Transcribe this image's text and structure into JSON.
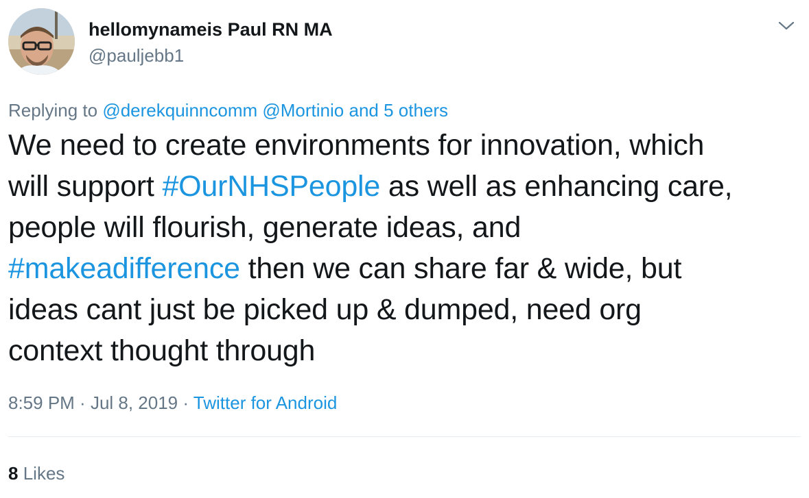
{
  "author": {
    "display_name": "hellomynameis Paul RN MA",
    "handle": "@pauljebb1"
  },
  "reply_context": {
    "prefix": "Replying to",
    "mention_1": "@derekquinncomm",
    "mention_2": "@Mortinio",
    "others": "and 5 others"
  },
  "tweet": {
    "line_1": "We need to create environments for innovation, which",
    "line_2_pre": "will support ",
    "hashtag_1": "#OurNHSPeople",
    "line_2_post": " as well as enhancing care,",
    "line_3": "people will flourish, generate ideas, and",
    "hashtag_2": "#makeadifference",
    "line_4_post": " then we can share far & wide, but",
    "line_5": "ideas cant just be picked up & dumped, need org",
    "line_6": "context thought through"
  },
  "meta": {
    "time": "8:59 PM",
    "separator_1": " · ",
    "date": "Jul 8, 2019",
    "separator_2": " · ",
    "source": "Twitter for Android"
  },
  "stats": {
    "likes_count": "8",
    "likes_label": "Likes"
  },
  "colors": {
    "link": "#1b95e0",
    "secondary_text": "#657786",
    "primary_text": "#14171a"
  },
  "icons": {
    "menu": "chevron-down-icon"
  }
}
